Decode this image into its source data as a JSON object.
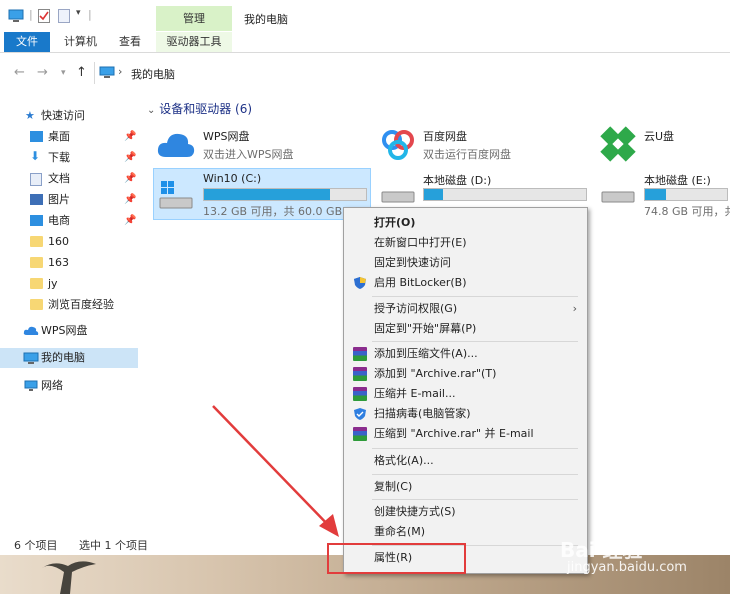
{
  "titlebar": {
    "manage_tab": "管理",
    "title": "我的电脑"
  },
  "ribbon": {
    "tabs": [
      "文件",
      "计算机",
      "查看",
      "驱动器工具"
    ]
  },
  "address": {
    "path": "我的电脑"
  },
  "nav": {
    "quick_access": "快速访问",
    "items": [
      {
        "label": "桌面",
        "pinned": true
      },
      {
        "label": "下载",
        "pinned": true
      },
      {
        "label": "文档",
        "pinned": true
      },
      {
        "label": "图片",
        "pinned": true
      },
      {
        "label": "电商",
        "pinned": true
      },
      {
        "label": "160",
        "pinned": false
      },
      {
        "label": "163",
        "pinned": false
      },
      {
        "label": "jy",
        "pinned": false
      },
      {
        "label": "浏览百度经验",
        "pinned": false
      }
    ],
    "wps": "WPS网盘",
    "computer": "我的电脑",
    "network": "网络"
  },
  "content": {
    "section_title": "设备和驱动器 (6)",
    "wps": {
      "name": "WPS网盘",
      "sub": "双击进入WPS网盘"
    },
    "baidu": {
      "name": "百度网盘",
      "sub": "双击运行百度网盘"
    },
    "yunpan": {
      "name": "云U盘"
    },
    "drive_c": {
      "name": "Win10 (C:)",
      "sub": "13.2 GB 可用，共 60.0 GB",
      "used_fraction": 0.78
    },
    "drive_d": {
      "name": "本地磁盘 (D:)",
      "used_fraction": 0.12
    },
    "drive_e": {
      "name": "本地磁盘 (E:)",
      "sub": "74.8 GB 可用，共",
      "used_fraction": 0.25
    }
  },
  "status": {
    "count": "6 个项目",
    "selected": "选中 1 个项目"
  },
  "context_menu": {
    "open": "打开(O)",
    "open_new_window": "在新窗口中打开(E)",
    "pin_quick": "固定到快速访问",
    "bitlocker": "启用 BitLocker(B)",
    "grant_access": "授予访问权限(G)",
    "pin_start": "固定到\"开始\"屏幕(P)",
    "add_archive": "添加到压缩文件(A)...",
    "add_archive_rar": "添加到 \"Archive.rar\"(T)",
    "compress_email": "压缩并 E-mail...",
    "scan_virus": "扫描病毒(电脑管家)",
    "compress_rar_email": "压缩到 \"Archive.rar\" 并 E-mail",
    "format": "格式化(A)...",
    "copy": "复制(C)",
    "create_shortcut": "创建快捷方式(S)",
    "rename": "重命名(M)",
    "properties": "属性(R)"
  },
  "watermark": {
    "brand": "Bai 经验",
    "url": "jingyan.baidu.com"
  },
  "colors": {
    "accent": "#1979ca",
    "selection": "#cce8ff",
    "progress": "#26a0da",
    "highlight_red": "#e23c3c"
  }
}
